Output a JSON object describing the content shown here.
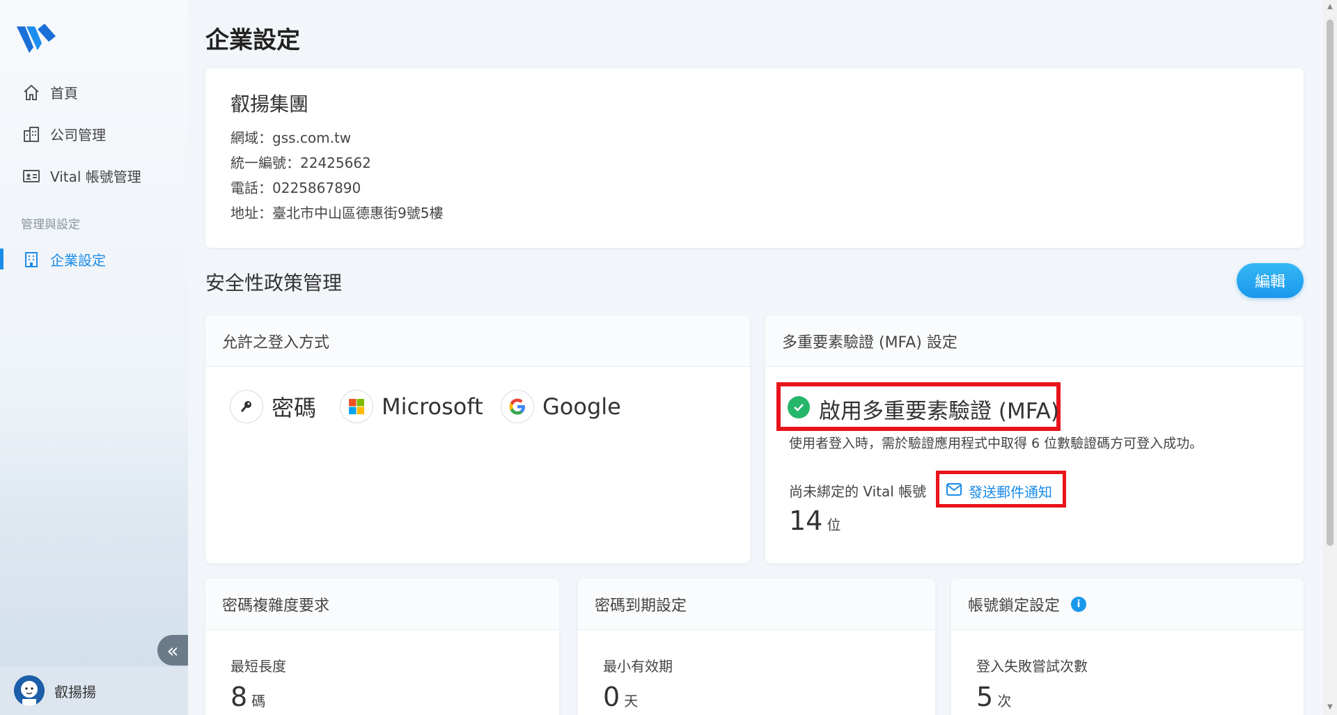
{
  "sidebar": {
    "nav": [
      {
        "label": "首頁"
      },
      {
        "label": "公司管理"
      },
      {
        "label": "Vital 帳號管理"
      }
    ],
    "section_label": "管理與設定",
    "active_item": {
      "label": "企業設定"
    },
    "collapse_glyph": "«",
    "user_name": "叡揚揚"
  },
  "page": {
    "title": "企業設定"
  },
  "company": {
    "name": "叡揚集團",
    "domain": "網域：gss.com.tw",
    "tax_id": "統一編號：22425662",
    "phone": "電話：0225867890",
    "address": "地址：臺北市中山區德惠街9號5樓"
  },
  "security": {
    "title": "安全性政策管理",
    "edit_label": "編輯",
    "login_methods": {
      "title": "允許之登入方式",
      "items": [
        {
          "label": "密碼",
          "icon": "key-icon"
        },
        {
          "label": "Microsoft",
          "icon": "microsoft-icon"
        },
        {
          "label": "Google",
          "icon": "google-icon"
        }
      ]
    },
    "mfa": {
      "title": "多重要素驗證 (MFA) 設定",
      "enabled_label": "啟用多重要素驗證 (MFA)",
      "description": "使用者登入時，需於驗證應用程式中取得 6 位數驗證碼方可登入成功。",
      "unbound_label": "尚未綁定的 Vital 帳號",
      "send_email_label": "發送郵件通知",
      "unbound_count": "14",
      "unbound_unit": "位"
    },
    "password_complexity": {
      "title": "密碼複雜度要求",
      "min_length_label": "最短長度",
      "min_length_value": "8",
      "min_length_unit": "碼"
    },
    "password_expiry": {
      "title": "密碼到期設定",
      "min_valid_label": "最小有效期",
      "min_valid_value": "0",
      "min_valid_unit": "天"
    },
    "account_lock": {
      "title": "帳號鎖定設定",
      "info_glyph": "i",
      "attempts_label": "登入失敗嘗試次數",
      "attempts_value": "5",
      "attempts_unit": "次"
    }
  },
  "colors": {
    "accent": "#1a8be8",
    "highlight_border": "#e8141b",
    "success": "#25b56b"
  }
}
